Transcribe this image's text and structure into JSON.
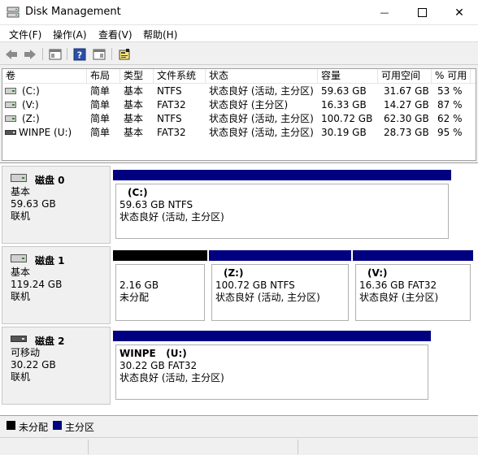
{
  "window": {
    "title": "Disk Management",
    "min_glyph": "—",
    "close_glyph": "✕"
  },
  "menu": [
    "文件(F)",
    "操作(A)",
    "查看(V)",
    "帮助(H)"
  ],
  "toolbar": {
    "icons": [
      "back-icon",
      "forward-icon",
      "console-icon",
      "help-icon",
      "properties-icon",
      "wizard-icon"
    ],
    "help_glyph": "?"
  },
  "volume_list": {
    "columns": [
      "卷",
      "布局",
      "类型",
      "文件系统",
      "状态",
      "容量",
      "可用空间",
      "% 可用"
    ],
    "rows": [
      {
        "volume": "(C:)",
        "layout": "简单",
        "type": "基本",
        "fs": "NTFS",
        "status": "状态良好 (活动, 主分区)",
        "capacity": "59.63 GB",
        "free": "31.67 GB",
        "pct": "53 %"
      },
      {
        "volume": "(V:)",
        "layout": "简单",
        "type": "基本",
        "fs": "FAT32",
        "status": "状态良好 (主分区)",
        "capacity": "16.33 GB",
        "free": "14.27 GB",
        "pct": "87 %"
      },
      {
        "volume": "(Z:)",
        "layout": "简单",
        "type": "基本",
        "fs": "NTFS",
        "status": "状态良好 (活动, 主分区)",
        "capacity": "100.72 GB",
        "free": "62.30 GB",
        "pct": "62 %"
      },
      {
        "volume": "WINPE (U:)",
        "layout": "简单",
        "type": "基本",
        "fs": "FAT32",
        "status": "状态良好 (活动, 主分区)",
        "capacity": "30.19 GB",
        "free": "28.73 GB",
        "pct": "95 %"
      }
    ]
  },
  "disks": [
    {
      "name": "磁盘 0",
      "type": "基本",
      "size": "59.63 GB",
      "state": "联机",
      "partitions": [
        {
          "name": "(C:)",
          "size": "59.63 GB NTFS",
          "status": "状态良好 (活动, 主分区)",
          "bar_color": "#000080"
        }
      ]
    },
    {
      "name": "磁盘 1",
      "type": "基本",
      "size": "119.24 GB",
      "state": "联机",
      "partitions": [
        {
          "name": "",
          "size": "2.16 GB",
          "status": "未分配",
          "bar_color": "#000000"
        },
        {
          "name": "(Z:)",
          "size": "100.72 GB NTFS",
          "status": "状态良好 (活动, 主分区)",
          "bar_color": "#000080"
        },
        {
          "name": "(V:)",
          "size": "16.36 GB FAT32",
          "status": "状态良好 (主分区)",
          "bar_color": "#000080"
        }
      ]
    },
    {
      "name": "磁盘 2",
      "type": "可移动",
      "size": "30.22 GB",
      "state": "联机",
      "partitions": [
        {
          "name": "WINPE   (U:)",
          "size": "30.22 GB FAT32",
          "status": "状态良好 (活动, 主分区)",
          "bar_color": "#000080"
        }
      ]
    }
  ],
  "legend": [
    {
      "label": "未分配",
      "color": "#000000"
    },
    {
      "label": "主分区",
      "color": "#000080"
    }
  ]
}
